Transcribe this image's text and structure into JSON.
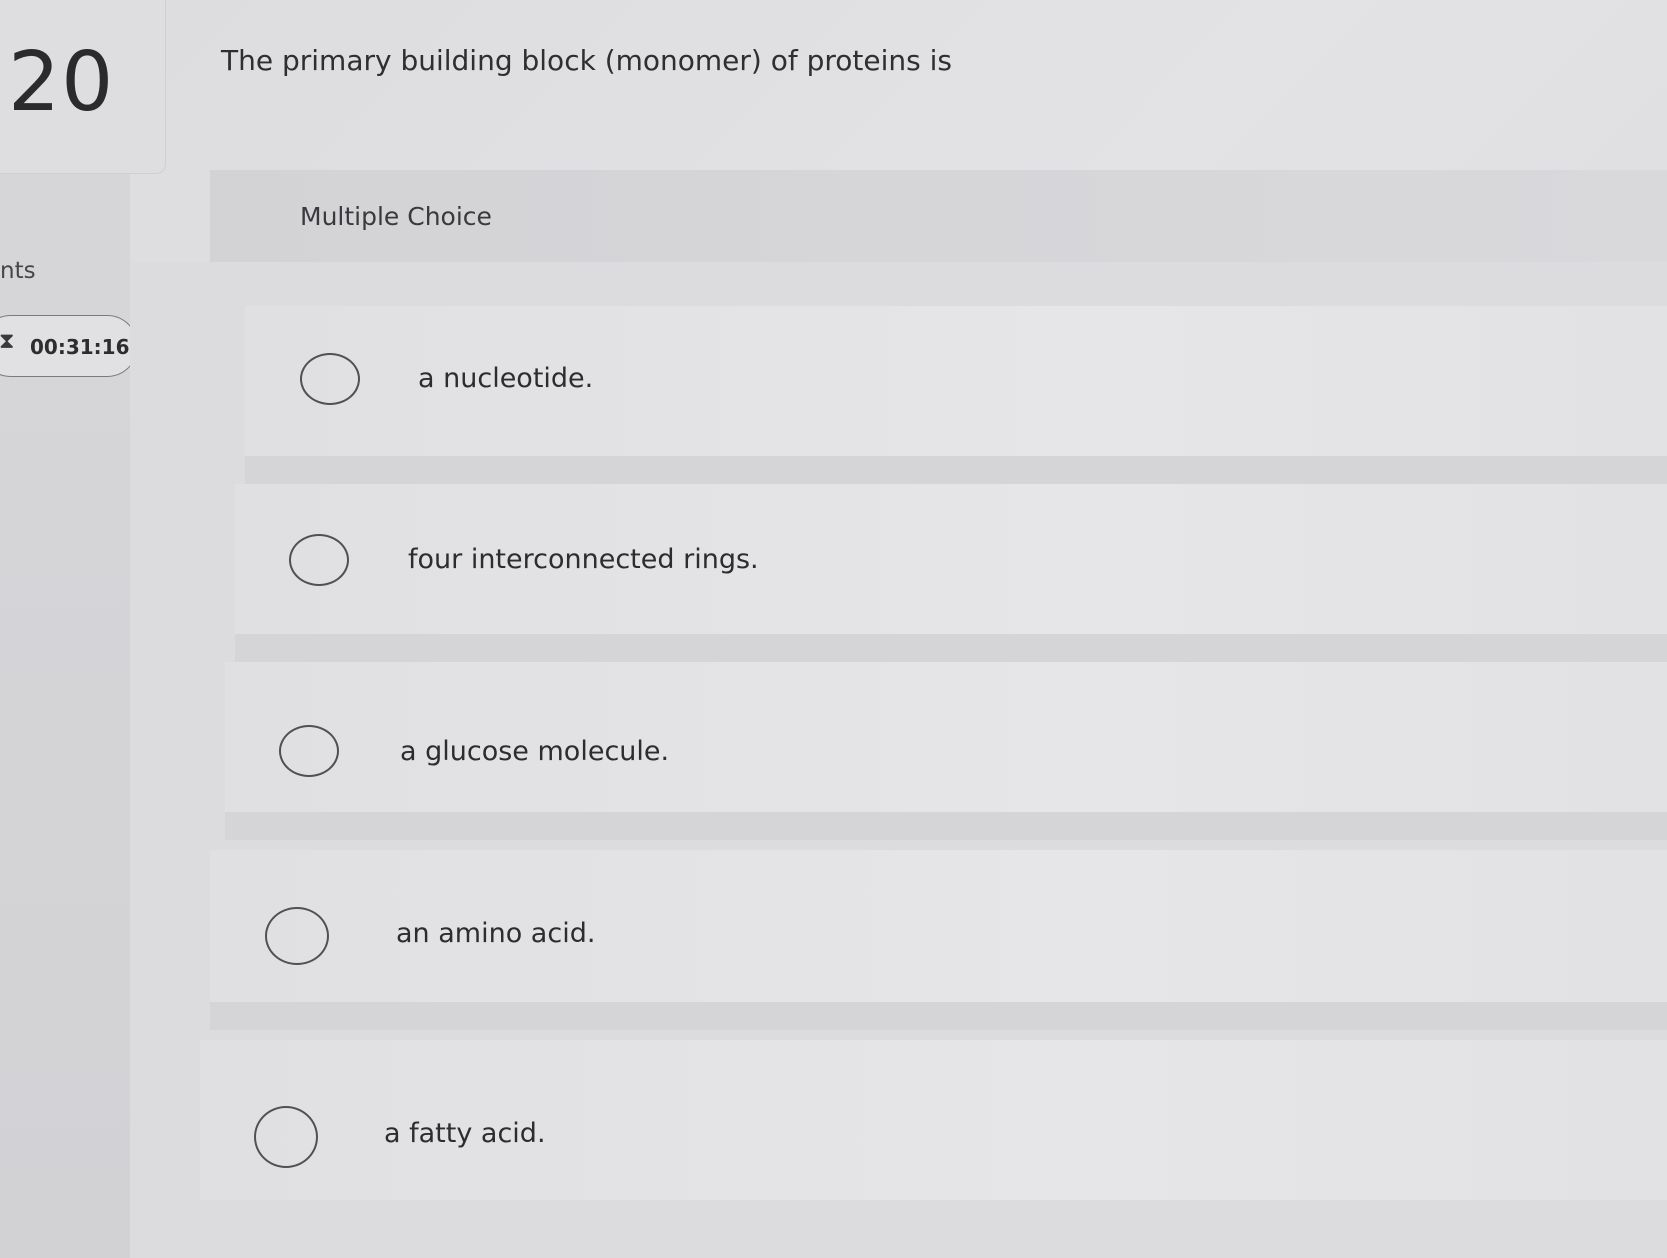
{
  "question": {
    "number": "20",
    "points_label": "nts",
    "timer": "00:31:16",
    "timer_icon": "hourglass-icon",
    "text": "The primary building block (monomer) of proteins is"
  },
  "answer_type": "Multiple Choice",
  "options": [
    {
      "label": "a nucleotide."
    },
    {
      "label": "four interconnected rings."
    },
    {
      "label": "a glucose molecule."
    },
    {
      "label": "an amino acid."
    },
    {
      "label": "a fatty acid."
    }
  ]
}
